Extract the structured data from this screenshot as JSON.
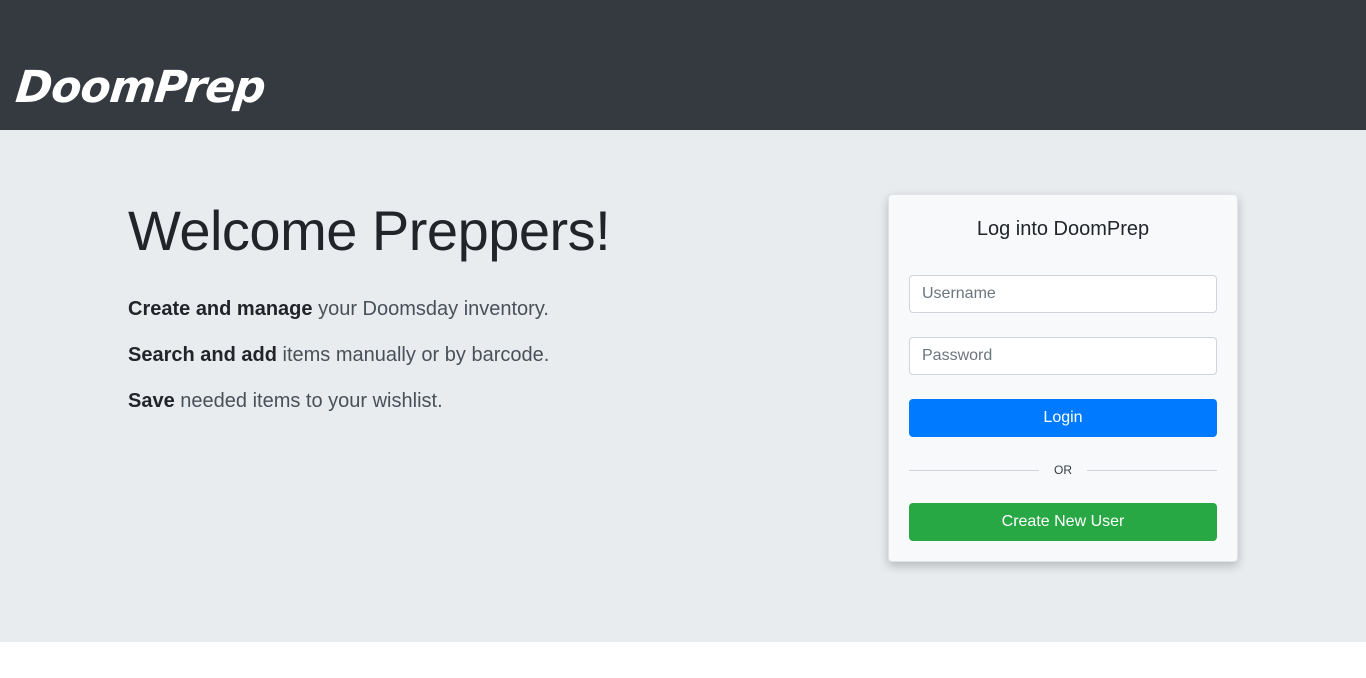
{
  "navbar": {
    "brand": "DoomPrep"
  },
  "hero": {
    "title": "Welcome Preppers!",
    "features": [
      {
        "strong": "Create and manage",
        "rest": " your Doomsday inventory."
      },
      {
        "strong": "Search and add",
        "rest": " items manually or by barcode."
      },
      {
        "strong": "Save",
        "rest": " needed items to your wishlist."
      }
    ]
  },
  "login": {
    "title": "Log into DoomPrep",
    "username_placeholder": "Username",
    "password_placeholder": "Password",
    "login_label": "Login",
    "divider_text": "OR",
    "create_label": "Create New User"
  },
  "colors": {
    "navbar_bg": "#343a40",
    "jumbotron_bg": "#e9ecef",
    "primary": "#007bff",
    "success": "#28a745"
  }
}
